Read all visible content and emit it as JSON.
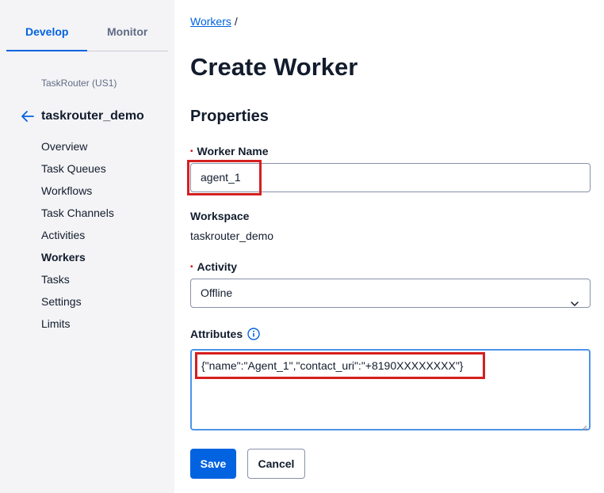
{
  "sidebar": {
    "tabs": [
      {
        "label": "Develop",
        "active": true
      },
      {
        "label": "Monitor",
        "active": false
      }
    ],
    "service_label": "TaskRouter (US1)",
    "back_icon": "arrow-left-icon",
    "workspace_title": "taskrouter_demo",
    "nav_items": [
      {
        "label": "Overview"
      },
      {
        "label": "Task Queues"
      },
      {
        "label": "Workflows"
      },
      {
        "label": "Task Channels"
      },
      {
        "label": "Activities"
      },
      {
        "label": "Workers",
        "active": true
      },
      {
        "label": "Tasks"
      },
      {
        "label": "Settings"
      },
      {
        "label": "Limits"
      }
    ]
  },
  "main": {
    "breadcrumb": {
      "link": "Workers",
      "separator": "/"
    },
    "title": "Create Worker",
    "section": "Properties",
    "worker_name": {
      "label": "Worker Name",
      "required_marker": "•",
      "value": "agent_1"
    },
    "workspace": {
      "label": "Workspace",
      "value": "taskrouter_demo"
    },
    "activity": {
      "label": "Activity",
      "required_marker": "•",
      "value": "Offline"
    },
    "attributes": {
      "label": "Attributes",
      "value": "{\"name\":\"Agent_1\",\"contact_uri\":\"+8190XXXXXXXX\"}"
    },
    "buttons": {
      "save": "Save",
      "cancel": "Cancel"
    }
  },
  "colors": {
    "primary": "#0263e0",
    "highlight": "#d61f1f",
    "sidebar_bg": "#f4f4f6",
    "focus_border": "#4d94e8"
  }
}
